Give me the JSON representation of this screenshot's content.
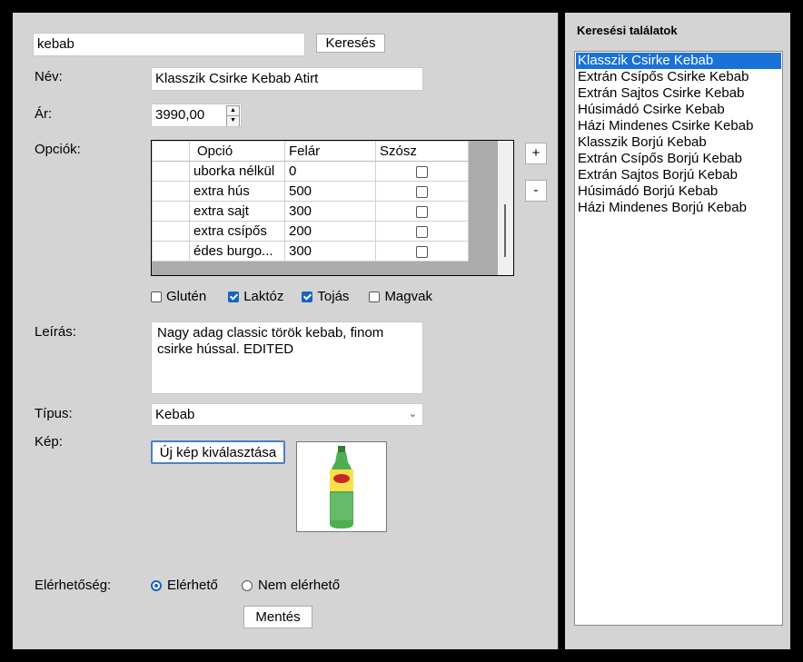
{
  "search": {
    "value": "kebab",
    "button": "Keresés"
  },
  "form": {
    "name_label": "Név:",
    "name_value": "Klasszik Csirke Kebab Atirt",
    "price_label": "Ár:",
    "price_value": "3990,00",
    "options_label": "Opciók:",
    "options_columns": [
      "Opció",
      "Felár",
      "Szósz"
    ],
    "options_rows": [
      {
        "option": "uborka nélkül",
        "surcharge": "0",
        "sauce": false
      },
      {
        "option": "extra hús",
        "surcharge": "500",
        "sauce": false
      },
      {
        "option": "extra sajt",
        "surcharge": "300",
        "sauce": false
      },
      {
        "option": "extra csípős",
        "surcharge": "200",
        "sauce": false
      },
      {
        "option": "édes burgo...",
        "surcharge": "300",
        "sauce": false
      }
    ],
    "add_option": "+",
    "remove_option": "-",
    "allergens": [
      {
        "label": "Glutén",
        "checked": false
      },
      {
        "label": "Laktóz",
        "checked": true
      },
      {
        "label": "Tojás",
        "checked": true
      },
      {
        "label": "Magvak",
        "checked": false
      }
    ],
    "description_label": "Leírás:",
    "description_value": "Nagy adag classic török kebab, finom csirke hússal. EDITED",
    "type_label": "Típus:",
    "type_value": "Kebab",
    "image_label": "Kép:",
    "image_button": "Új kép kiválasztása",
    "availability_label": "Elérhetőség:",
    "available": "Elérhető",
    "not_available": "Nem elérhető",
    "available_selected": true,
    "save": "Mentés"
  },
  "results": {
    "title": "Keresési találatok",
    "items": [
      "Klasszik Csirke Kebab",
      "Extrán Csípős Csirke Kebab",
      "Extrán Sajtos Csirke Kebab",
      "Húsimádó Csirke Kebab",
      "Házi Mindenes Csirke Kebab",
      "Klasszik Borjú Kebab",
      "Extrán Csípős Borjú Kebab",
      "Extrán Sajtos Borjú Kebab",
      "Húsimádó Borjú Kebab",
      "Házi Mindenes Borjú Kebab"
    ],
    "selected_index": 0
  },
  "colors": {
    "accent": "#1a72d6",
    "panel": "#d4d4d4"
  }
}
